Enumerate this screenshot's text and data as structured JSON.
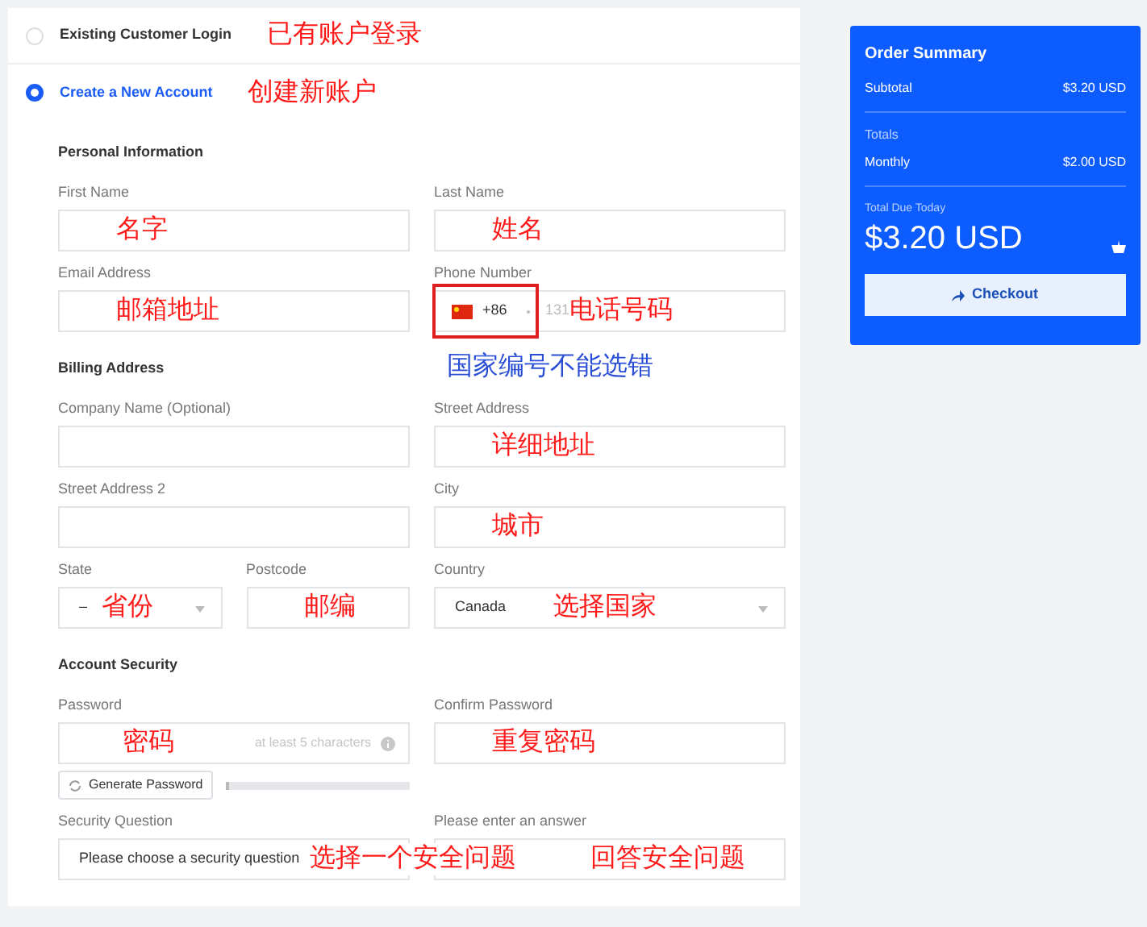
{
  "account_options": [
    {
      "label": "Existing Customer Login",
      "selected": false,
      "annotation": "已有账户登录"
    },
    {
      "label": "Create a New Account",
      "selected": true,
      "annotation": "创建新账户"
    }
  ],
  "sections": [
    {
      "title": "Personal Information",
      "rows": [
        [
          {
            "kind": "text",
            "label": "First Name",
            "annotation": "名字"
          },
          {
            "kind": "text",
            "label": "Last Name",
            "annotation": "姓名"
          }
        ],
        [
          {
            "kind": "text",
            "label": "Email Address",
            "annotation": "邮箱地址"
          },
          {
            "kind": "phone",
            "label": "Phone Number",
            "country_code": "+86",
            "placeholder": "131",
            "highlighted": true,
            "annotation": "电话号码",
            "note": "国家编号不能选错"
          }
        ]
      ]
    },
    {
      "title": "Billing Address",
      "rows": [
        [
          {
            "kind": "text",
            "label": "Company Name (Optional)"
          },
          {
            "kind": "text",
            "label": "Street Address",
            "annotation": "详细地址"
          }
        ],
        [
          {
            "kind": "text",
            "label": "Street Address 2"
          },
          {
            "kind": "text",
            "label": "City",
            "annotation": "城市"
          }
        ],
        [
          {
            "kind": "select",
            "label": "State",
            "value": "–",
            "annotation": "省份"
          },
          {
            "kind": "text",
            "label": "Postcode",
            "annotation": "邮编"
          },
          {
            "kind": "select",
            "label": "Country",
            "value": "Canada",
            "annotation": "选择国家"
          }
        ]
      ]
    },
    {
      "title": "Account Security",
      "rows": [
        [
          {
            "kind": "password",
            "label": "Password",
            "placeholder": "at least 5 characters",
            "annotation": "密码",
            "generate_button": "Generate Password",
            "strength": {
              "level": 0.01
            }
          },
          {
            "kind": "text",
            "label": "Confirm Password",
            "annotation": "重复密码"
          }
        ],
        [
          {
            "kind": "select",
            "label": "Security Question",
            "value": "Please choose a security question",
            "annotation": "选择一个安全问题"
          },
          {
            "kind": "text",
            "label": "Please enter an answer",
            "annotation": "回答安全问题"
          }
        ]
      ]
    }
  ],
  "order_summary": {
    "title": "Order Summary",
    "subtotal": {
      "label": "Subtotal",
      "value": "$3.20 USD"
    },
    "totals_label": "Totals",
    "monthly": {
      "label": "Monthly",
      "value": "$2.00 USD"
    },
    "total_due_label": "Total Due Today",
    "total_due": "$3.20 USD",
    "checkout_button": "Checkout"
  }
}
